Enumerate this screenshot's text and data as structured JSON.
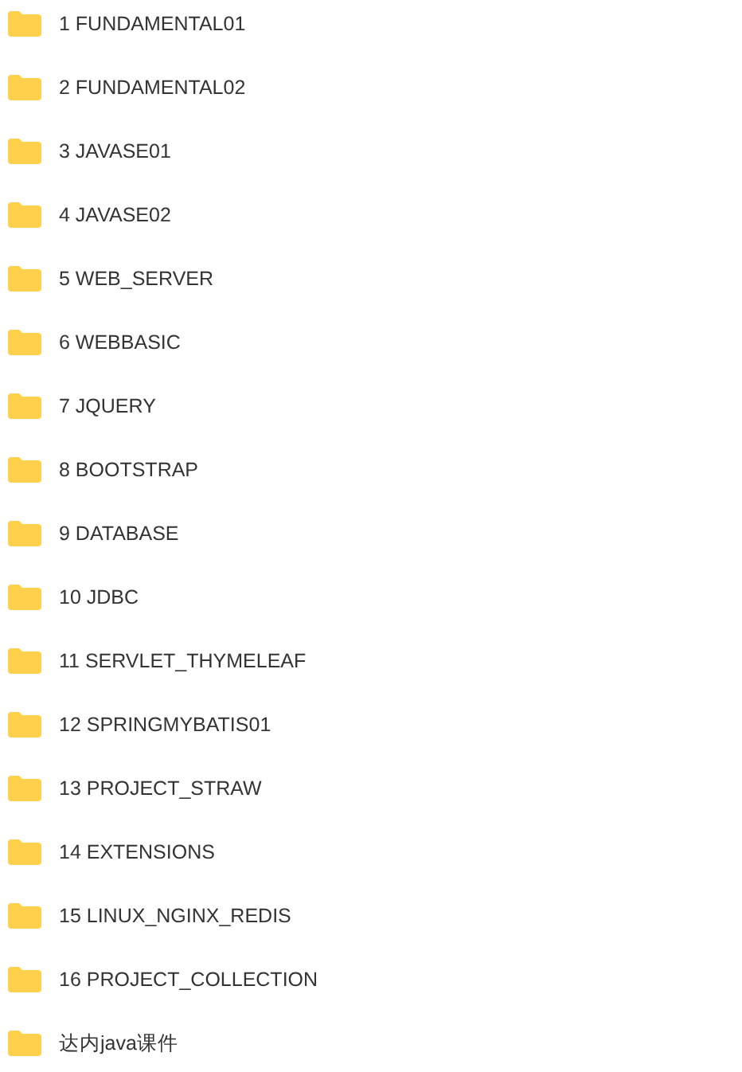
{
  "folders": [
    {
      "name": "1 FUNDAMENTAL01"
    },
    {
      "name": "2 FUNDAMENTAL02"
    },
    {
      "name": "3 JAVASE01"
    },
    {
      "name": "4 JAVASE02"
    },
    {
      "name": "5 WEB_SERVER"
    },
    {
      "name": "6 WEBBASIC"
    },
    {
      "name": "7 JQUERY"
    },
    {
      "name": "8 BOOTSTRAP"
    },
    {
      "name": "9 DATABASE"
    },
    {
      "name": "10 JDBC"
    },
    {
      "name": "11 SERVLET_THYMELEAF"
    },
    {
      "name": "12 SPRINGMYBATIS01"
    },
    {
      "name": "13 PROJECT_STRAW"
    },
    {
      "name": "14 EXTENSIONS"
    },
    {
      "name": "15 LINUX_NGINX_REDIS"
    },
    {
      "name": "16 PROJECT_COLLECTION"
    },
    {
      "name": "达内java课件"
    }
  ]
}
